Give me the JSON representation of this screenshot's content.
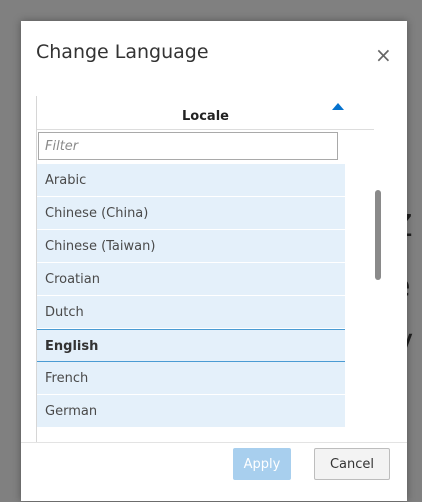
{
  "background": {
    "line1": "Z",
    "line2": "e",
    "line3": "V"
  },
  "dialog": {
    "title": "Change Language",
    "close_symbol": "×",
    "table": {
      "column_header": "Locale",
      "sort_direction": "ascending",
      "filter_placeholder": "Filter",
      "filter_value": "",
      "rows": [
        {
          "label": "Arabic",
          "selected": false
        },
        {
          "label": "Chinese (China)",
          "selected": false
        },
        {
          "label": "Chinese (Taiwan)",
          "selected": false
        },
        {
          "label": "Croatian",
          "selected": false
        },
        {
          "label": "Dutch",
          "selected": false
        },
        {
          "label": "English",
          "selected": true
        },
        {
          "label": "French",
          "selected": false
        },
        {
          "label": "German",
          "selected": false
        }
      ]
    },
    "buttons": {
      "apply": "Apply",
      "cancel": "Cancel"
    }
  },
  "colors": {
    "accent": "#0572ce",
    "row_background": "#e4f0fa",
    "apply_disabled": "#a8cfee"
  }
}
